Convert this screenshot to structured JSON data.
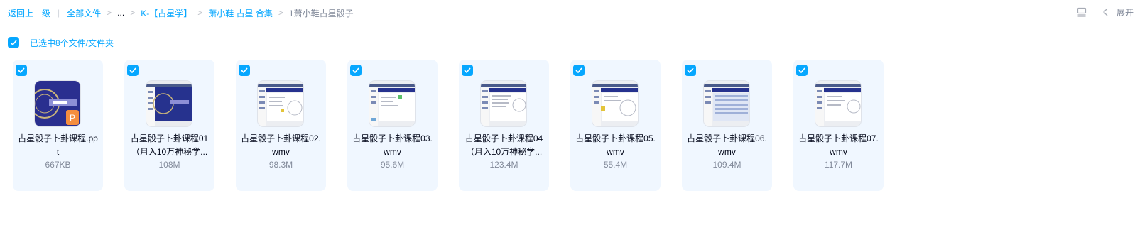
{
  "breadcrumb": {
    "back": "返回上一级",
    "root": "全部文件",
    "ellipsis": "...",
    "level1": "K-【占星学】",
    "level2": "萧小鞋 占星 合集",
    "current": "1萧小鞋占星骰子"
  },
  "toolbar": {
    "expand_label": "展开",
    "list_view_icon": "list-view-icon",
    "collapse_icon": "chevron-left-icon"
  },
  "selection": {
    "label": "已选中8个文件/文件夹"
  },
  "colors": {
    "accent": "#06a7ff",
    "tile_bg": "#f0f7ff",
    "text_primary": "#03081a",
    "text_secondary": "#818999"
  },
  "files": [
    {
      "name": "占星骰子卜卦课程.ppt",
      "size": "667KB",
      "type": "ppt",
      "checked": true
    },
    {
      "name": "占星骰子卜卦课程01（月入10万神秘学...",
      "size": "108M",
      "type": "video",
      "checked": true
    },
    {
      "name": "占星骰子卜卦课程02.wmv",
      "size": "98.3M",
      "type": "video",
      "checked": true
    },
    {
      "name": "占星骰子卜卦课程03.wmv",
      "size": "95.6M",
      "type": "video",
      "checked": true
    },
    {
      "name": "占星骰子卜卦课程04（月入10万神秘学...",
      "size": "123.4M",
      "type": "video",
      "checked": true
    },
    {
      "name": "占星骰子卜卦课程05.wmv",
      "size": "55.4M",
      "type": "video",
      "checked": true
    },
    {
      "name": "占星骰子卜卦课程06.wmv",
      "size": "109.4M",
      "type": "video",
      "checked": true
    },
    {
      "name": "占星骰子卜卦课程07.wmv",
      "size": "117.7M",
      "type": "video",
      "checked": true
    }
  ]
}
